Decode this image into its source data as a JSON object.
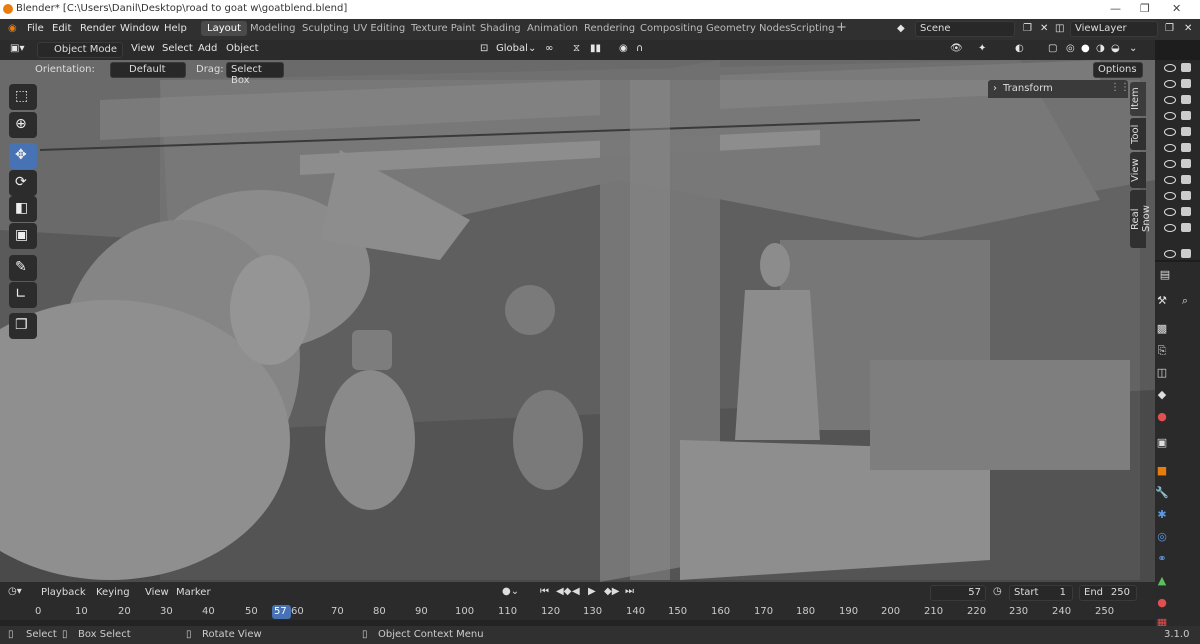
{
  "window": {
    "title": "Blender* [C:\\Users\\Danil\\Desktop\\road to goat w\\goatblend.blend]"
  },
  "menu": [
    "File",
    "Edit",
    "Render",
    "Window",
    "Help"
  ],
  "workspaces": [
    "Layout",
    "Modeling",
    "Sculpting",
    "UV Editing",
    "Texture Paint",
    "Shading",
    "Animation",
    "Rendering",
    "Compositing",
    "Geometry Nodes",
    "Scripting"
  ],
  "active_workspace": "Layout",
  "scene": {
    "scene_name": "Scene",
    "view_layer": "ViewLayer"
  },
  "viewport_header": {
    "mode": "Object Mode",
    "menus": [
      "View",
      "Select",
      "Add",
      "Object"
    ],
    "transform_orientation": "Global"
  },
  "tool_options": {
    "orientation_label": "Orientation:",
    "orientation_value": "Default",
    "drag_label": "Drag:",
    "drag_value": "Select Box",
    "options_label": "Options"
  },
  "sidebar": {
    "panel_title": "Transform",
    "tabs": [
      "Item",
      "Tool",
      "View",
      "Real Snow"
    ]
  },
  "toolbar_icons": [
    "select-box-icon",
    "cursor-icon",
    "move-icon",
    "rotate-icon",
    "scale-icon",
    "transform-icon",
    "annotate-icon",
    "measure-icon",
    "add-cube-icon"
  ],
  "timeline": {
    "menus": [
      "Playback",
      "Keying",
      "View",
      "Marker"
    ],
    "current_frame": "57",
    "start_label": "Start",
    "start_value": "1",
    "end_label": "End",
    "end_value": "250",
    "ruler_ticks": [
      "0",
      "10",
      "20",
      "30",
      "40",
      "50",
      "60",
      "70",
      "80",
      "90",
      "100",
      "110",
      "120",
      "130",
      "140",
      "150",
      "160",
      "170",
      "180",
      "190",
      "200",
      "210",
      "220",
      "230",
      "240",
      "250"
    ],
    "playhead_label": "57"
  },
  "status": {
    "select": "Select",
    "box_select": "Box Select",
    "rotate_view": "Rotate View",
    "context_menu": "Object Context Menu",
    "version": "3.1.0"
  },
  "colors": {
    "accent": "#4772b3",
    "active_frame": "#4772b3",
    "blender_orange": "#e87d0d"
  }
}
